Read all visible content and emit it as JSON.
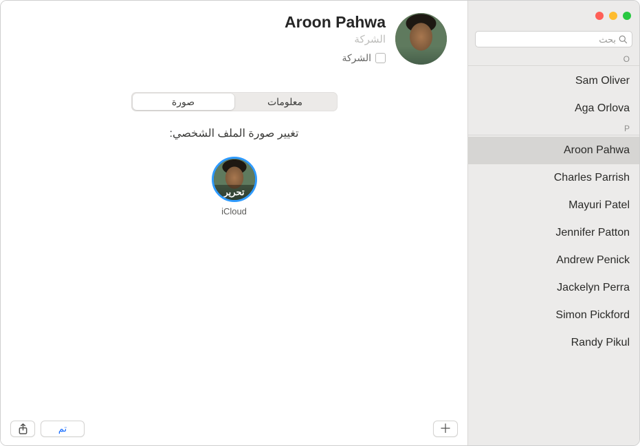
{
  "search": {
    "placeholder": "بحث"
  },
  "sections": {
    "o": {
      "letter": "O",
      "items": [
        "Sam Oliver",
        "Aga Orlova"
      ]
    },
    "p": {
      "letter": "P",
      "items": [
        "Aroon Pahwa",
        "Charles Parrish",
        "Mayuri Patel",
        "Jennifer Patton",
        "Andrew Penick",
        "Jackelyn Perra",
        "Simon Pickford",
        "Randy Pikul"
      ],
      "selected_index": 0
    }
  },
  "detail": {
    "name": "Aroon  Pahwa",
    "company_placeholder": "الشركة",
    "company_checkbox_label": "الشركة"
  },
  "segmented": {
    "info": "معلومات",
    "photo": "صورة",
    "active": "photo"
  },
  "photo_panel": {
    "change_label": "تغيير صورة الملف الشخصي:",
    "edit_label": "تحرير",
    "source_caption": "iCloud"
  },
  "toolbar": {
    "done_label": "تم"
  }
}
